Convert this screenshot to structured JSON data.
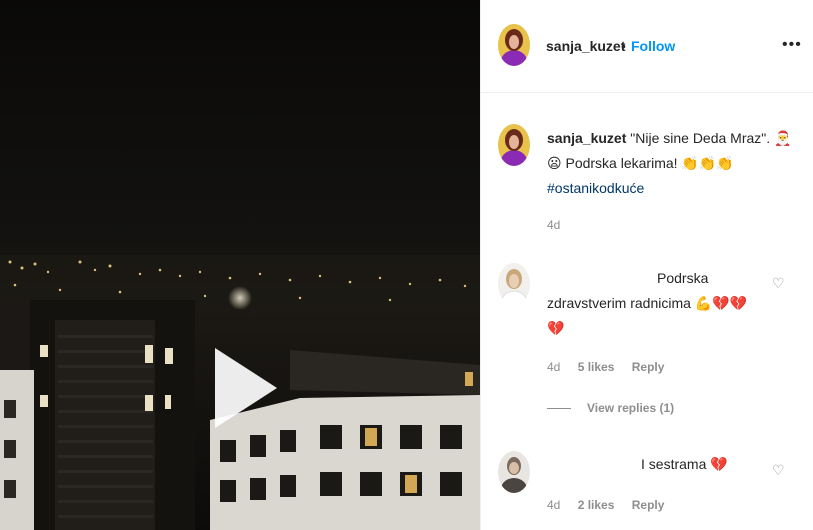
{
  "post": {
    "username": "sanja_kuzet",
    "follow_dot": "•",
    "follow_label": "Follow",
    "more_label": "•••",
    "caption_text_1": "\"Nije sine Deda Mraz\". 🎅",
    "caption_text_2": "😦 Podrska lekarima! 👏👏👏",
    "hashtag": "#ostanikodkuće",
    "time": "4d"
  },
  "comments": [
    {
      "text_1": "Podrska",
      "text_2": "zdravstverim radnicima 💪💔💔",
      "text_3": "💔",
      "time": "4d",
      "likes": "5 likes",
      "reply": "Reply",
      "view_replies": "View replies (1)"
    },
    {
      "text_1": "I sestrama 💔",
      "time": "4d",
      "likes": "2 likes",
      "reply": "Reply"
    }
  ],
  "icons": {
    "heart": "♡",
    "play": "play-icon"
  },
  "colors": {
    "follow": "#0095f6",
    "hashtag": "#00376b",
    "meta": "#8e8e8e"
  }
}
